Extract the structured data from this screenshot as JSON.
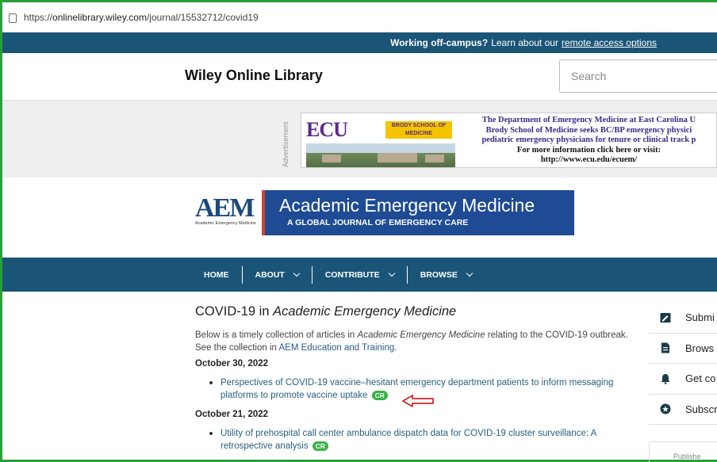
{
  "browser": {
    "url_prefix": "https://",
    "url_host": "onlinelibrary.wiley.com",
    "url_path": "/journal/15532712/covid19"
  },
  "offcampus": {
    "bold": "Working off-campus?",
    "text": "Learn about our",
    "link": "remote access options"
  },
  "header": {
    "logo": "Wiley Online Library",
    "search_placeholder": "Search"
  },
  "ad": {
    "label": "Advertisement",
    "ecu_logo": "ECU",
    "ecu_school": "BRODY SCHOOL OF MEDICINE",
    "line1": "The Department of Emergency Medicine at East Carolina U",
    "line2": "Brody School of Medicine seeks BC/BP emergency physici",
    "line3": "pediatric emergency physicians for tenure or clinical track p",
    "line4": "For more information click here or visit:",
    "line5": "http://www.ecu.edu/ecuem/"
  },
  "journal": {
    "logo_letters": "AEM",
    "logo_sub": "Academic Emergency Medicine",
    "title": "Academic Emergency Medicine",
    "subtitle": "A GLOBAL JOURNAL OF EMERGENCY CARE"
  },
  "nav": {
    "items": [
      {
        "label": "HOME",
        "dropdown": false
      },
      {
        "label": "ABOUT",
        "dropdown": true
      },
      {
        "label": "CONTRIBUTE",
        "dropdown": true
      },
      {
        "label": "BROWSE",
        "dropdown": true
      }
    ]
  },
  "main": {
    "title_plain": "COVID-19 in ",
    "title_italic": "Academic Emergency Medicine",
    "intro_1": "Below is a timely collection of articles in ",
    "intro_italic": "Academic Emergency Medicine",
    "intro_2": " relating to the COVID-19 outbreak. See the collection in ",
    "intro_link": "AEM Education and Training",
    "intro_end": ".",
    "sections": [
      {
        "date": "October 30, 2022",
        "article": "Perspectives of COVID-19 vaccine–hesitant emergency department patients to inform messaging platforms to promote vaccine uptake",
        "badge": "CR"
      },
      {
        "date": "October 21, 2022",
        "article": "Utility of prehospital call center ambulance dispatch data for COVID-19 cluster surveillance: A retrospective analysis",
        "badge": "CR"
      }
    ]
  },
  "sidebar": {
    "items": [
      {
        "label": "Submi",
        "icon": "edit-icon"
      },
      {
        "label": "Brows",
        "icon": "document-icon"
      },
      {
        "label": "Get co",
        "icon": "bell-icon"
      },
      {
        "label": "Subscr",
        "icon": "star-icon"
      }
    ],
    "published": "Publishe"
  },
  "colors": {
    "nav_blue": "#1a5577",
    "aem_blue": "#1e4b94",
    "accent_red": "#d6412b",
    "badge_green": "#38b247",
    "frame_green": "#29a03a"
  }
}
